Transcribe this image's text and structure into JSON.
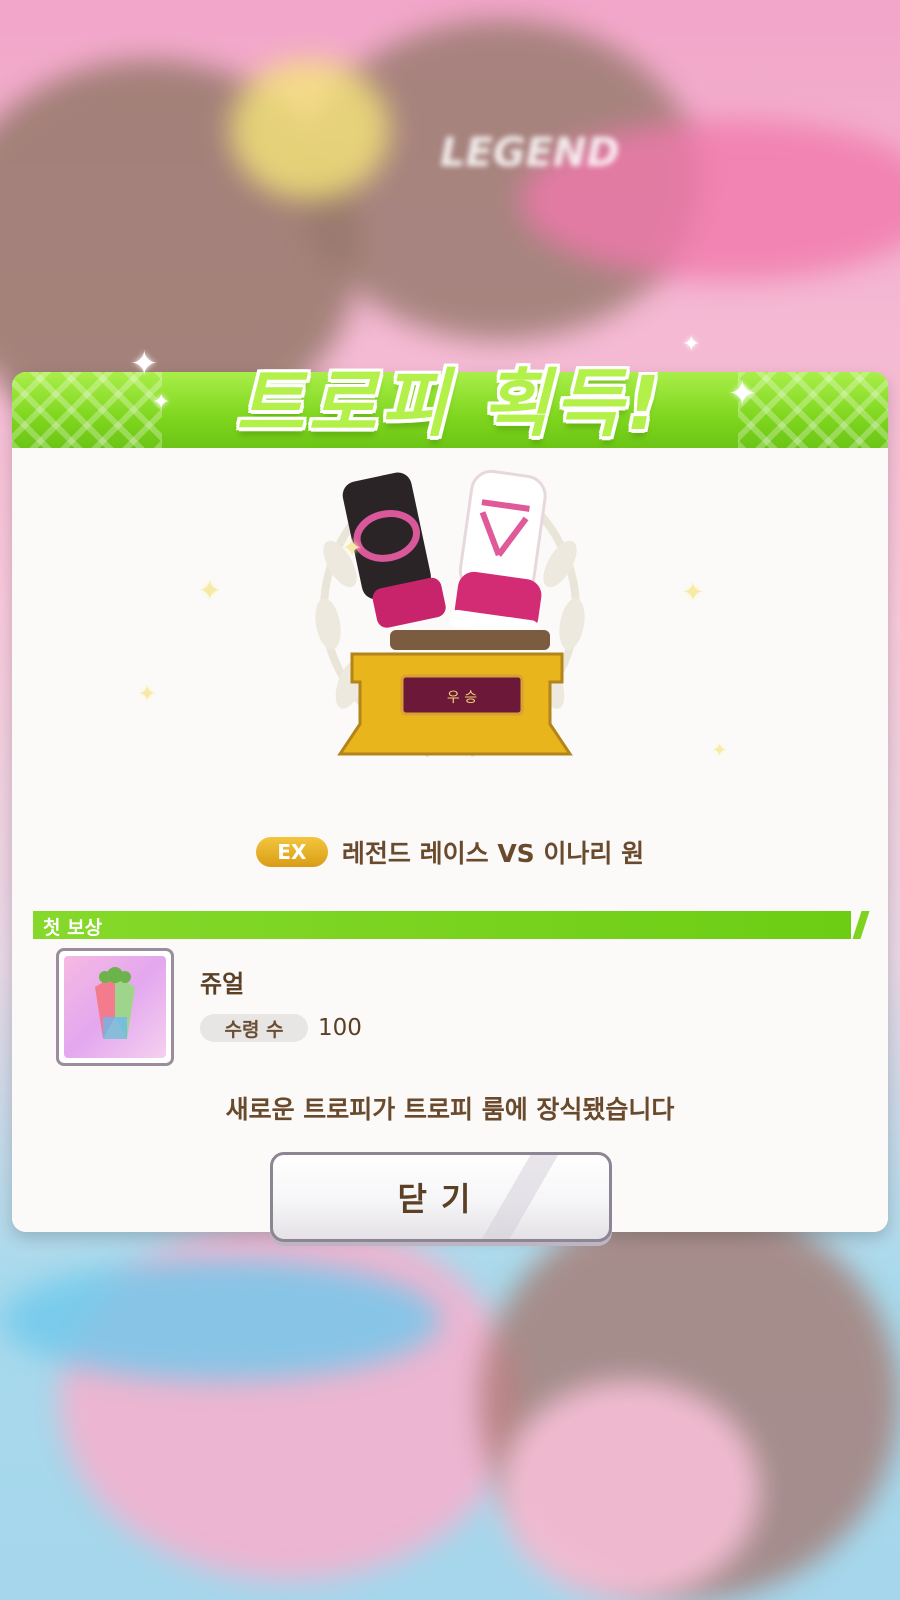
{
  "header": {
    "title": "트로피 획득!"
  },
  "trophy": {
    "plate_text": "우 승"
  },
  "race": {
    "grade_badge": "EX",
    "name": "레전드 레이스 VS 이나리 원"
  },
  "reward_section": {
    "label": "첫 보상",
    "item": {
      "name": "쥬얼",
      "quantity_label": "수령 수",
      "quantity": "100",
      "icon": "jewel-icon"
    }
  },
  "notice": "새로운 트로피가 트로피 룸에 장식됐습니다",
  "close_button": {
    "label": "닫기"
  },
  "background": {
    "banner_top_title": "LEGEND",
    "banner_top_sub1": "",
    "banner_top_sub2": ""
  },
  "colors": {
    "accent_green": "#7fd61e",
    "text_brown": "#5b4026",
    "badge_gold": "#e0a820"
  }
}
